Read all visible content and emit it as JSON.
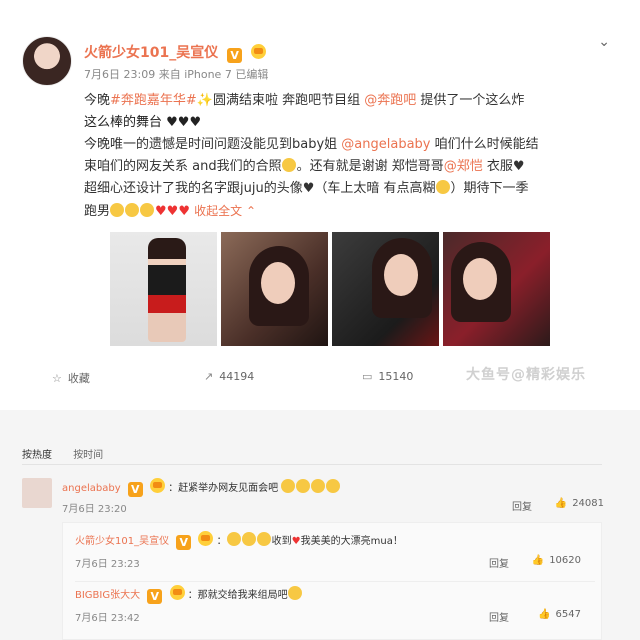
{
  "post": {
    "username": "火箭少女101_吴宣仪",
    "vip_badge": "V",
    "time": "7月6日 23:09",
    "source": "来自 iPhone 7",
    "edited": "已编辑",
    "text_line1_a": "今晚",
    "topic": "#奔跑嘉年华#",
    "text_line1_b": "✨圆满结束啦",
    "text_line1_c": " 奔跑吧节目组 ",
    "mention_benpao": "@奔跑吧",
    "text_line1_d": " 提供了一个这么炸",
    "text_line2": "这么棒的舞台 ♥♥♥",
    "text_line3_a": "今晚唯一的遗憾是时间问题没能见到baby姐 ",
    "mention_angela": "@angelababy",
    "text_line3_b": " 咱们什么时候能结",
    "text_line4_a": "束咱们的网友关系 and我们的合照",
    "text_line4_b": "。还有就是谢谢 郑恺哥哥",
    "mention_zhengkai": "@郑恺",
    "text_line4_c": " 衣服♥",
    "text_line5": "超细心还设计了我的名字跟juju的头像♥（车上太暗 有点高糊",
    "text_line5_b": "）期待下一季",
    "text_line6": "跑男",
    "hearts": "♥♥♥",
    "collapse": "收起全文 ⌃",
    "chevron": "⌄"
  },
  "actions": {
    "collect_icon": "☆",
    "collect_label": "收藏",
    "repost_icon": "↗",
    "repost_count": "44194",
    "comment_icon": "▭",
    "comment_count": "15140",
    "like_icon": "♡"
  },
  "watermark": "大鱼号@精彩娱乐",
  "comments": {
    "sort_hot": "按热度",
    "sort_time": "按时间",
    "top": {
      "name": "angelababy",
      "text": "：赶紧举办网友见面会吧",
      "time": "7月6日 23:20",
      "reply_label": "回复",
      "thumb_icon": "👍",
      "likes": "24081"
    },
    "replies": [
      {
        "name": "火箭少女101_吴宣仪",
        "text_a": "：",
        "text_b": "收到",
        "text_c": "我美美的大漂亮mua！",
        "time": "7月6日 23:23",
        "reply_label": "回复",
        "likes": "10620"
      },
      {
        "name": "BIGBIG张大大",
        "text_a": "：那就交给我来组局吧",
        "time": "7月6日 23:42",
        "reply_label": "回复",
        "likes": "6547"
      }
    ]
  },
  "colors": {
    "accent": "#eb7350",
    "badge": "#f7a21b",
    "text": "#333333",
    "meta": "#888888"
  }
}
